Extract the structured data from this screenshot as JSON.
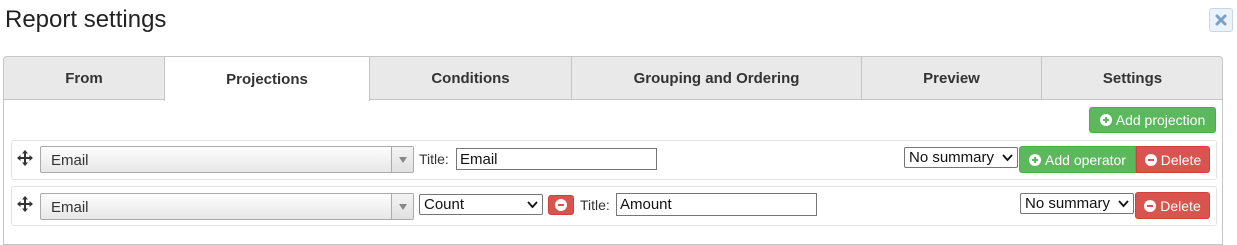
{
  "dialog": {
    "title": "Report settings"
  },
  "tabs": [
    {
      "label": "From"
    },
    {
      "label": "Projections",
      "active": true
    },
    {
      "label": "Conditions"
    },
    {
      "label": "Grouping and Ordering"
    },
    {
      "label": "Preview"
    },
    {
      "label": "Settings"
    }
  ],
  "toolbar": {
    "add_projection_label": "Add projection"
  },
  "projections": [
    {
      "field": "Email",
      "title_label": "Title:",
      "title_value": "Email",
      "summary": "No summary",
      "add_operator_label": "Add operator",
      "delete_label": "Delete"
    },
    {
      "field": "Email",
      "operator": "Count",
      "title_label": "Title:",
      "title_value": "Amount",
      "summary": "No summary",
      "delete_label": "Delete"
    }
  ],
  "colors": {
    "green": "#5cb85c",
    "red": "#d9534f",
    "tab_bg": "#e9e9e9"
  }
}
